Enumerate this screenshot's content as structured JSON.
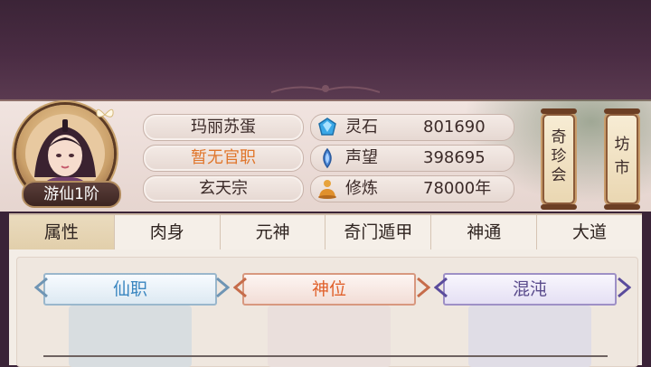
{
  "player": {
    "rank_badge": "游仙1阶",
    "name": "玛丽苏蛋",
    "official_post": "暂无官职",
    "sect": "玄天宗"
  },
  "stats": [
    {
      "icon": "spirit-stone-icon",
      "label": "灵石",
      "value": "801690"
    },
    {
      "icon": "reputation-icon",
      "label": "声望",
      "value": "398695"
    },
    {
      "icon": "cultivation-icon",
      "label": "修炼",
      "value": "78000年"
    }
  ],
  "side_buttons": [
    {
      "name": "treasure-shop-button",
      "chars": [
        "奇",
        "珍",
        "会"
      ]
    },
    {
      "name": "market-button",
      "chars": [
        "坊",
        "市"
      ]
    }
  ],
  "tabs": [
    "属性",
    "肉身",
    "元神",
    "奇门遁甲",
    "神通",
    "大道"
  ],
  "active_tab": "属性",
  "slots": [
    {
      "title": "仙职",
      "color": "#3a86c0"
    },
    {
      "title": "神位",
      "color": "#e0602a"
    },
    {
      "title": "混沌",
      "color": "#5a4b8c"
    }
  ]
}
